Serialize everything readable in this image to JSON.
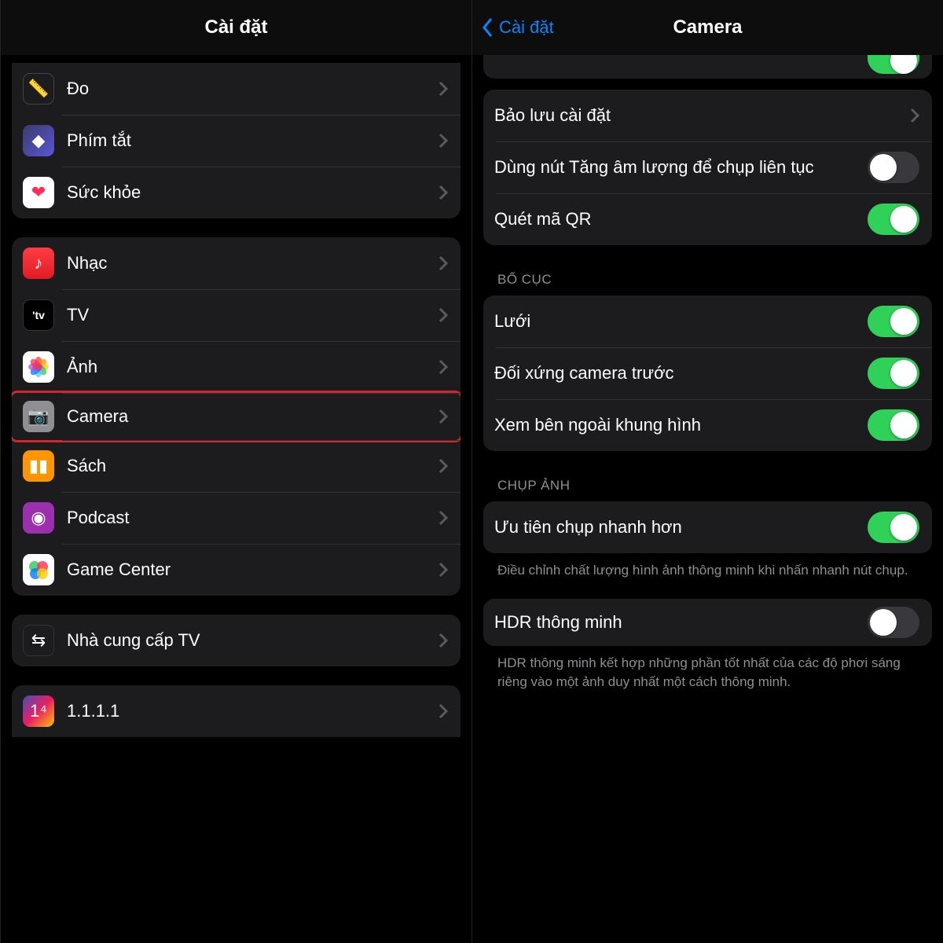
{
  "left": {
    "title": "Cài đặt",
    "groups": [
      {
        "partialTop": true,
        "items": [
          {
            "name": "measure",
            "label": "Đo",
            "iconGlyph": "📏",
            "iconClass": "ic-measure"
          },
          {
            "name": "shortcuts",
            "label": "Phím tắt",
            "iconGlyph": "◆",
            "iconClass": "ic-shortcuts"
          },
          {
            "name": "health",
            "label": "Sức khỏe",
            "iconGlyph": "❤",
            "iconClass": "ic-health",
            "iconColor": "#ff2d55"
          }
        ]
      },
      {
        "items": [
          {
            "name": "music",
            "label": "Nhạc",
            "iconGlyph": "♪",
            "iconClass": "ic-music"
          },
          {
            "name": "tv",
            "label": "TV",
            "iconGlyph": "'tv",
            "iconClass": "ic-tv"
          },
          {
            "name": "photos",
            "label": "Ảnh",
            "iconSvg": "photos",
            "iconClass": "ic-photos"
          },
          {
            "name": "camera",
            "label": "Camera",
            "iconGlyph": "📷",
            "iconClass": "ic-camera",
            "highlight": true
          },
          {
            "name": "books",
            "label": "Sách",
            "iconGlyph": "▮▮",
            "iconClass": "ic-books"
          },
          {
            "name": "podcast",
            "label": "Podcast",
            "iconGlyph": "◉",
            "iconClass": "ic-podcast"
          },
          {
            "name": "gamecenter",
            "label": "Game Center",
            "iconSvg": "gc",
            "iconClass": "ic-gamecenter"
          }
        ]
      },
      {
        "items": [
          {
            "name": "tv-provider",
            "label": "Nhà cung cấp TV",
            "iconGlyph": "⇆",
            "iconClass": "ic-tvprovider"
          }
        ]
      },
      {
        "partialBottom": true,
        "items": [
          {
            "name": "app-1111",
            "label": "1.1.1.1",
            "iconGlyph": "1⁴",
            "iconClass": "ic-1111"
          }
        ]
      }
    ]
  },
  "right": {
    "backLabel": "Cài đặt",
    "title": "Camera",
    "topPartialToggle": {
      "on": true
    },
    "groups": [
      {
        "items": [
          {
            "name": "preserve-settings",
            "label": "Bảo lưu cài đặt",
            "accessory": "chevron"
          },
          {
            "name": "burst-volume-up",
            "label": "Dùng nút Tăng âm lượng để chụp liên tục",
            "accessory": "toggle",
            "on": false
          },
          {
            "name": "scan-qr",
            "label": "Quét mã QR",
            "accessory": "toggle",
            "on": true
          }
        ]
      },
      {
        "header": "BỐ CỤC",
        "items": [
          {
            "name": "grid",
            "label": "Lưới",
            "accessory": "toggle",
            "on": true
          },
          {
            "name": "mirror-front",
            "label": "Đối xứng camera trước",
            "accessory": "toggle",
            "on": true
          },
          {
            "name": "outside-frame",
            "label": "Xem bên ngoài khung hình",
            "accessory": "toggle",
            "on": true
          }
        ]
      },
      {
        "header": "CHỤP ẢNH",
        "items": [
          {
            "name": "faster-shot",
            "label": "Ưu tiên chụp nhanh hơn",
            "accessory": "toggle",
            "on": true
          }
        ],
        "footer": "Điều chỉnh chất lượng hình ảnh thông minh khi nhấn nhanh nút chụp."
      },
      {
        "items": [
          {
            "name": "smart-hdr",
            "label": "HDR thông minh",
            "accessory": "toggle",
            "on": false,
            "highlight": true
          }
        ],
        "footer": "HDR thông minh kết hợp những phần tốt nhất của các độ phơi sáng riêng vào một ảnh duy nhất một cách thông minh."
      }
    ]
  }
}
